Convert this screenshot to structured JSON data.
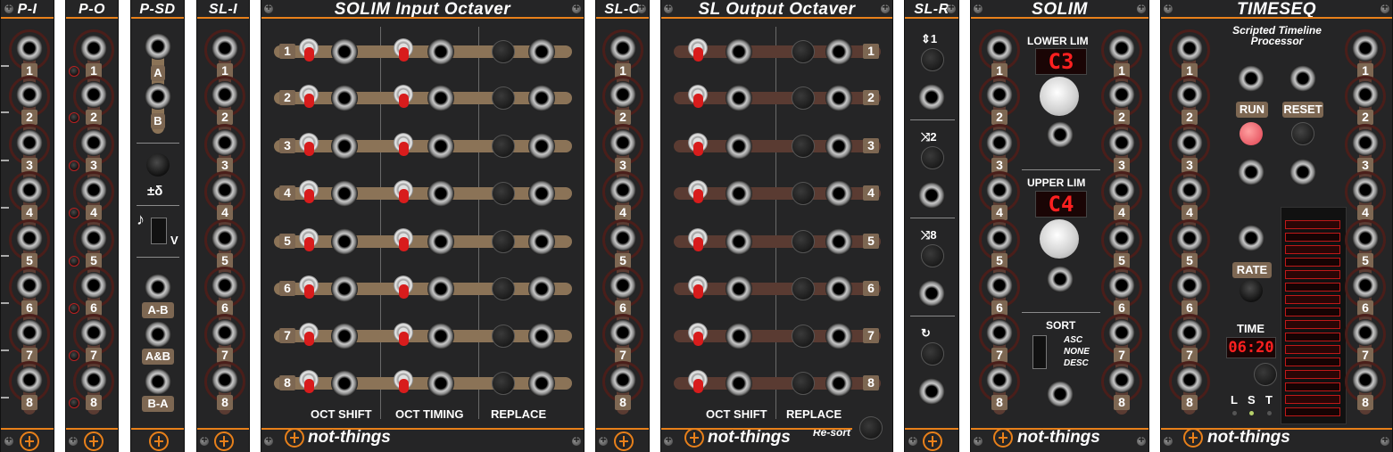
{
  "modules": {
    "p_i": {
      "title": "P-I",
      "numbers": [
        "1",
        "2",
        "3",
        "4",
        "5",
        "6",
        "7",
        "8"
      ]
    },
    "p_o": {
      "title": "P-O",
      "numbers": [
        "1",
        "2",
        "3",
        "4",
        "5",
        "6",
        "7",
        "8"
      ]
    },
    "p_sd": {
      "title": "P-SD",
      "labels": {
        "a": "A",
        "b": "B",
        "delta": "±δ",
        "v": "V",
        "note": "♪",
        "a_minus_b": "A-B",
        "a_and_b": "A&B",
        "b_minus_a": "B-A"
      }
    },
    "sl_i": {
      "title": "SL-I",
      "numbers": [
        "1",
        "2",
        "3",
        "4",
        "5",
        "6",
        "7",
        "8"
      ]
    },
    "solim_input_octaver": {
      "title": "SOLIM Input Octaver",
      "numbers": [
        "1",
        "2",
        "3",
        "4",
        "5",
        "6",
        "7",
        "8"
      ],
      "columns": [
        "OCT SHIFT",
        "OCT TIMING",
        "REPLACE"
      ],
      "brand": "not-things"
    },
    "sl_o": {
      "title": "SL-O",
      "numbers": [
        "1",
        "2",
        "3",
        "4",
        "5",
        "6",
        "7",
        "8"
      ]
    },
    "sl_output_octaver": {
      "title": "SL Output Octaver",
      "numbers": [
        "1",
        "2",
        "3",
        "4",
        "5",
        "6",
        "7",
        "8"
      ],
      "columns": [
        "OCT SHIFT",
        "REPLACE"
      ],
      "resort": "Re-sort",
      "brand": "not-things"
    },
    "sl_r": {
      "title": "SL-R",
      "buttons": [
        "⇕1",
        "⤨2",
        "⤨8",
        "↻"
      ]
    },
    "solim": {
      "title": "SOLIM",
      "numbers": [
        "1",
        "2",
        "3",
        "4",
        "5",
        "6",
        "7",
        "8"
      ],
      "lower_lim": "LOWER LIM",
      "lower_value": "C3",
      "upper_lim": "UPPER LIM",
      "upper_value": "C4",
      "sort": "SORT",
      "sort_options": [
        "ASC",
        "NONE",
        "DESC"
      ],
      "brand": "not-things"
    },
    "timeseq": {
      "title": "TIMESEQ",
      "subtitle": "Scripted Timeline Processor",
      "numbers": [
        "1",
        "2",
        "3",
        "4",
        "5",
        "6",
        "7",
        "8"
      ],
      "run": "RUN",
      "reset": "RESET",
      "rate": "RATE",
      "time": "TIME",
      "time_value": "06:20",
      "lst": [
        "L",
        "S",
        "T"
      ],
      "brand": "not-things"
    }
  },
  "colors": {
    "panel": "#252526",
    "accent": "#e8801a",
    "tag": "#7d6752",
    "led_red": "#ff2020"
  }
}
